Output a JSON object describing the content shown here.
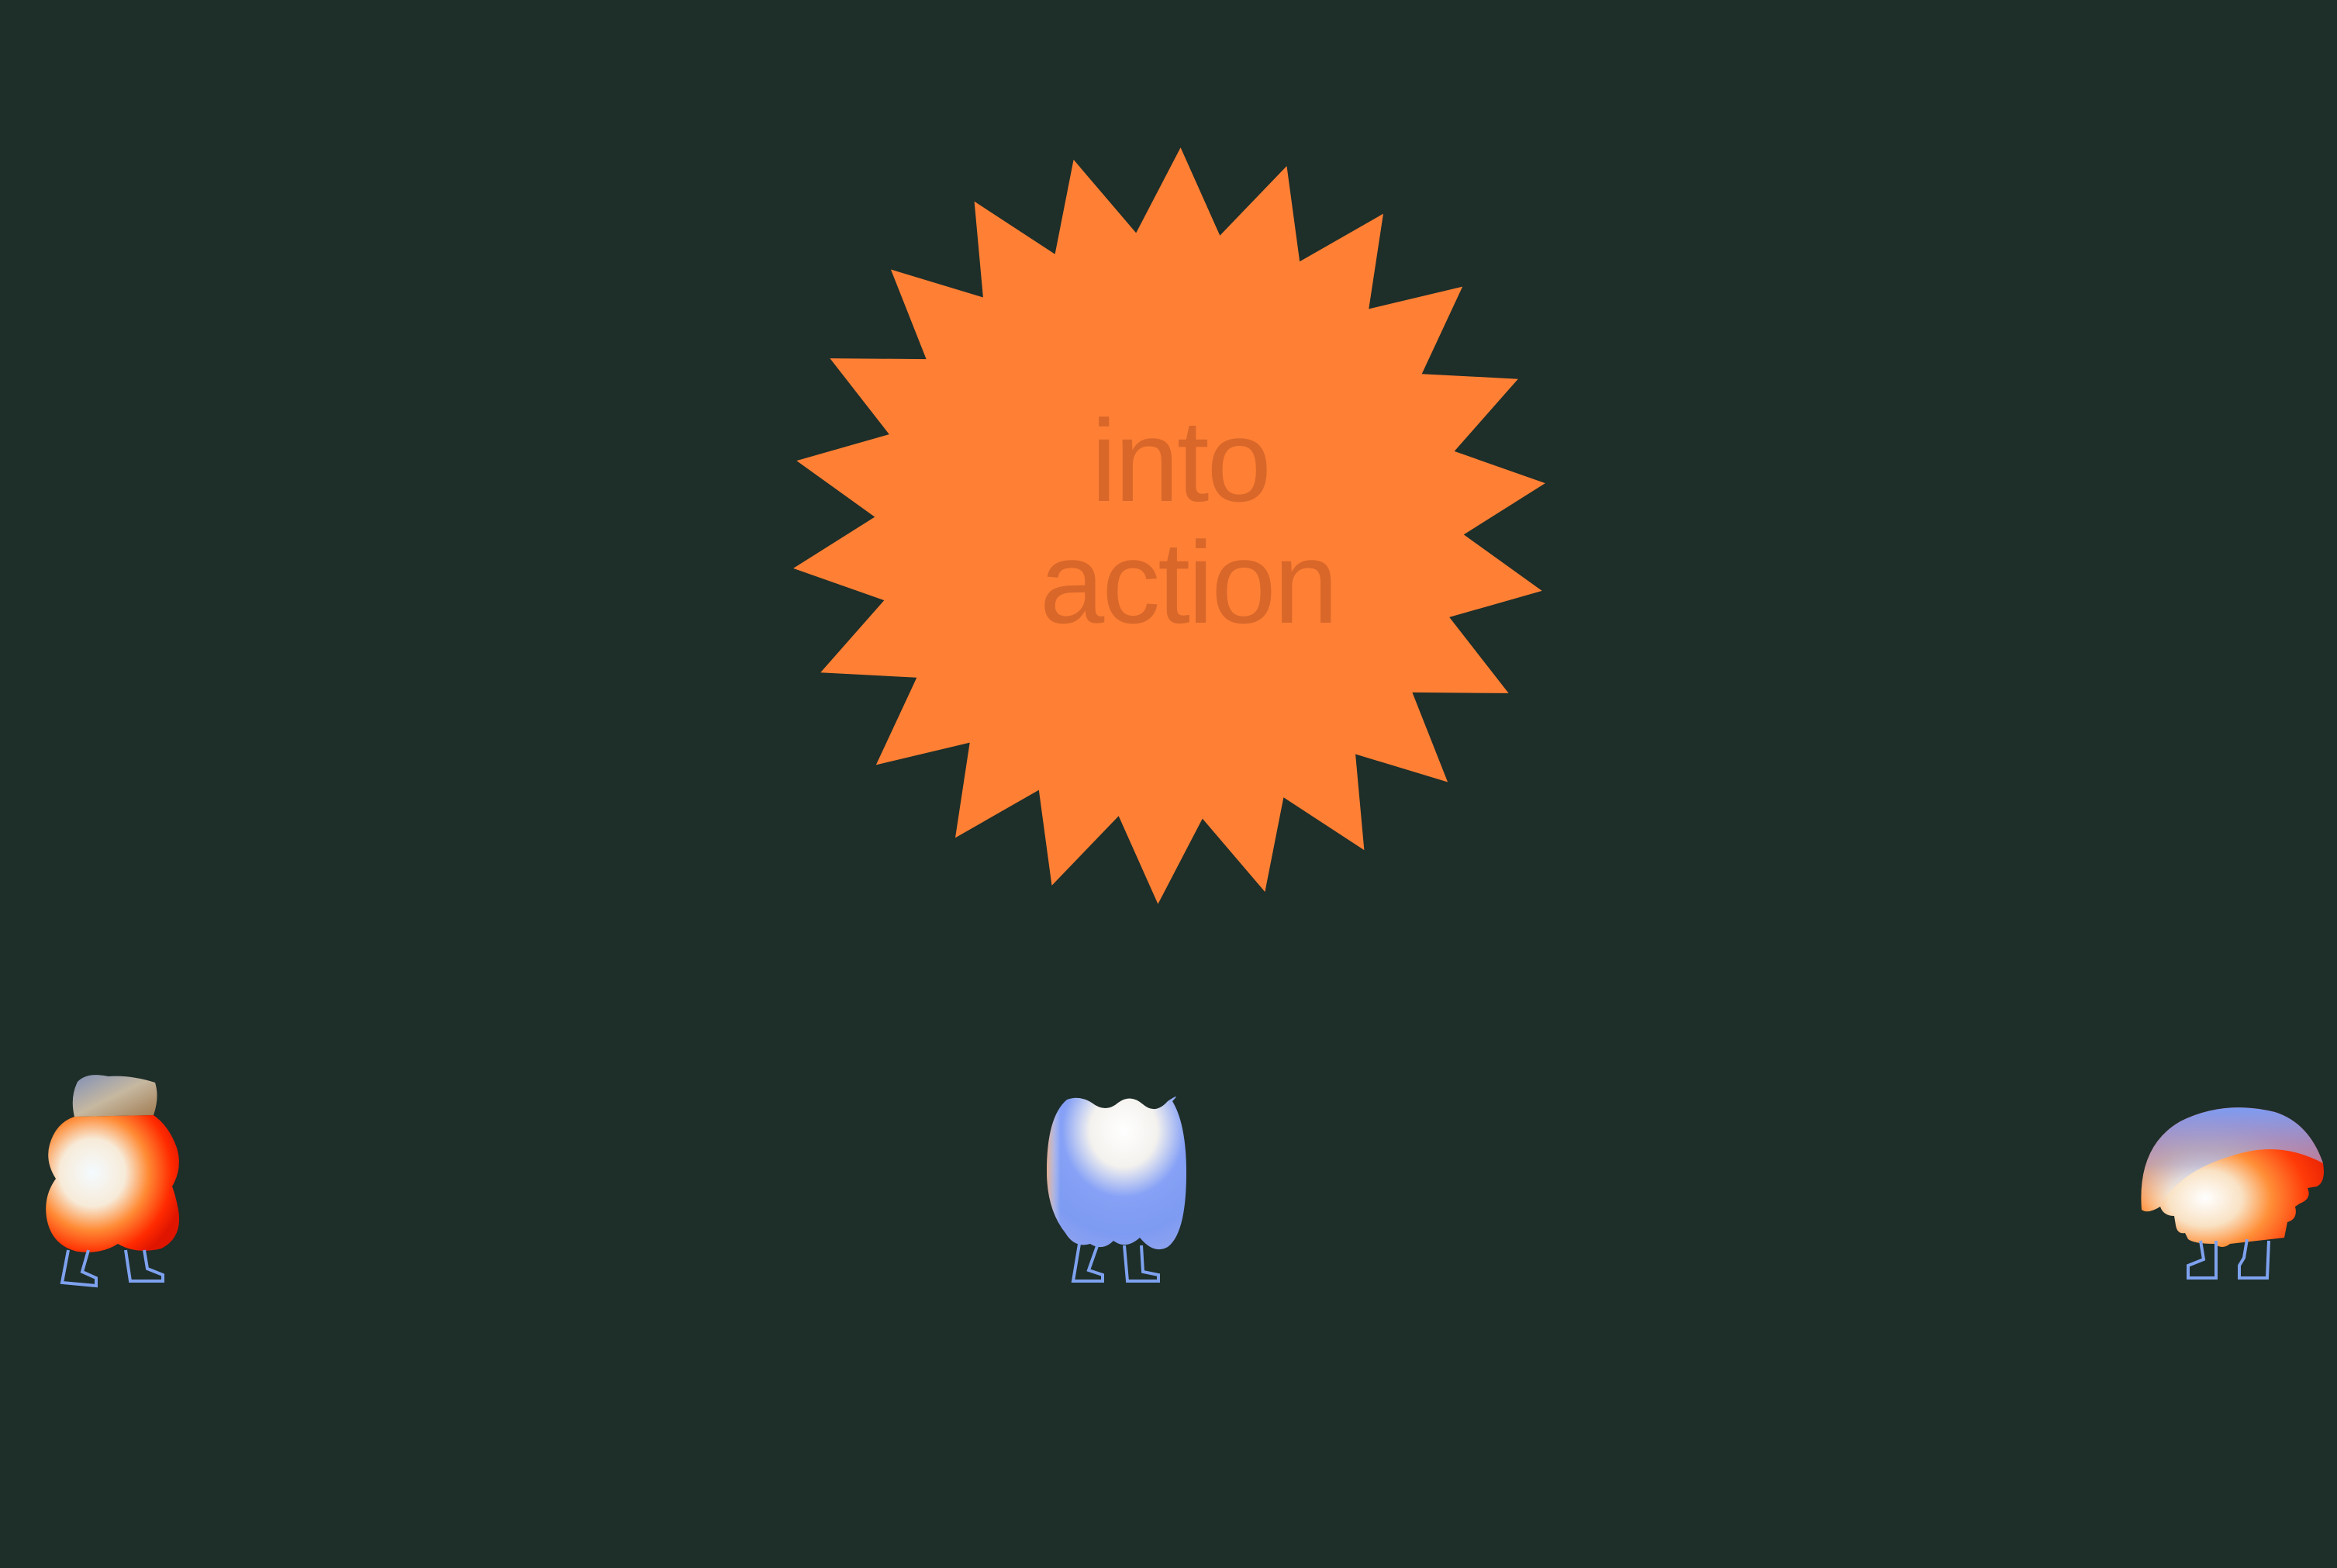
{
  "canvas": {
    "background": "#1e2e29"
  },
  "burst": {
    "color": "#ff8034",
    "text_color": "#d9672a",
    "lines": [
      "into",
      "action"
    ]
  },
  "characters": [
    {
      "name": "blob-character",
      "colors": [
        "#f5f8ff",
        "#ff7a1c",
        "#ff2a00",
        "#7d9bf2"
      ]
    },
    {
      "name": "bean-character",
      "colors": [
        "#ffffff",
        "#7d9bf2",
        "#ff9a50"
      ]
    },
    {
      "name": "dome-character",
      "colors": [
        "#7d9bf2",
        "#ffffff",
        "#ff7a1c",
        "#e51c00"
      ]
    }
  ],
  "legs_color": "#7ea2ef"
}
